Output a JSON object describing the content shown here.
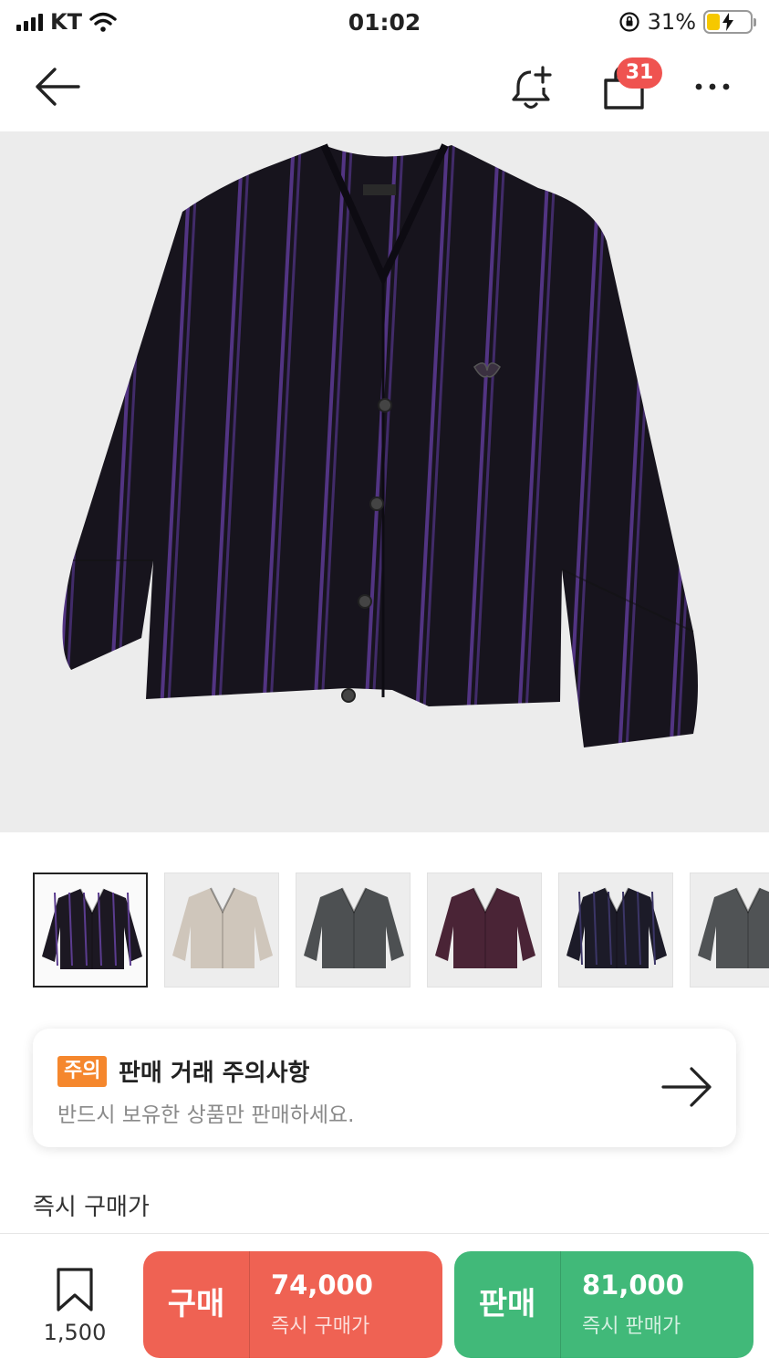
{
  "status_bar": {
    "carrier": "KT",
    "time": "01:02",
    "battery": "31%",
    "battery_level": 0.31
  },
  "nav": {
    "cart_badge": "31"
  },
  "thumbnails": [
    {
      "color": "#1c1822",
      "stripe": "#5b3c8f",
      "selected": true
    },
    {
      "color": "#cfc6bb",
      "stripe": "",
      "selected": false
    },
    {
      "color": "#4d5052",
      "stripe": "",
      "selected": false
    },
    {
      "color": "#4a2436",
      "stripe": "",
      "selected": false
    },
    {
      "color": "#1c1b28",
      "stripe": "#3b3566",
      "selected": false
    },
    {
      "color": "#505355",
      "stripe": "",
      "selected": false
    }
  ],
  "caution": {
    "badge": "주의",
    "title": "판매 거래 주의사항",
    "subtitle": "반드시 보유한 상품만 판매하세요."
  },
  "instant_price_label": "즉시 구매가",
  "bottom_bar": {
    "wish_count": "1,500",
    "buy": {
      "label": "구매",
      "price": "74,000",
      "sub": "즉시 구매가"
    },
    "sell": {
      "label": "판매",
      "price": "81,000",
      "sub": "즉시 판매가"
    }
  },
  "colors": {
    "buy": "#ef6253",
    "sell": "#41b979",
    "badge": "#ef5350",
    "caution": "#f5872d",
    "cardigan": "#1b1721",
    "stripe": "#5e3c96"
  }
}
